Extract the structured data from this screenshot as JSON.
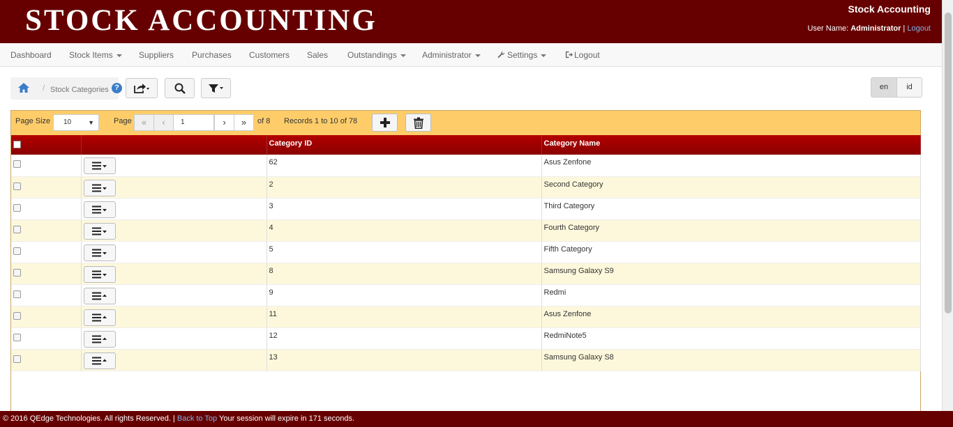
{
  "header": {
    "app_title": "STOCK ACCOUNTING",
    "brand_small": "Stock Accounting",
    "user_label": "User Name:",
    "user_name": "Administrator",
    "separator": "|",
    "logout_link": "Logout"
  },
  "nav": {
    "items": [
      {
        "label": "Dashboard",
        "icon": "",
        "dropdown": false
      },
      {
        "label": "Stock Items",
        "icon": "",
        "dropdown": true
      },
      {
        "label": "Suppliers",
        "icon": "",
        "dropdown": false
      },
      {
        "label": "Purchases",
        "icon": "",
        "dropdown": false
      },
      {
        "label": "Customers",
        "icon": "",
        "dropdown": false
      },
      {
        "label": "Sales",
        "icon": "",
        "dropdown": false
      },
      {
        "label": "Outstandings",
        "icon": "",
        "dropdown": true
      },
      {
        "label": "Administrator",
        "icon": "",
        "dropdown": true
      },
      {
        "label": "Settings",
        "icon": "wrench-icon",
        "dropdown": true
      },
      {
        "label": "Logout",
        "icon": "sign-out-icon",
        "dropdown": false
      }
    ]
  },
  "breadcrumb": {
    "home_icon": "home-icon",
    "separator": "/",
    "current": "Stock Categories",
    "help_icon": "question-circle-icon",
    "help_glyph": "?"
  },
  "toolbar": {
    "export_icon": "share-icon",
    "search_icon": "search-icon",
    "filter_icon": "filter-icon"
  },
  "language": {
    "options": [
      "en",
      "id"
    ],
    "active": "en"
  },
  "pager": {
    "page_size_label": "Page Size",
    "page_size_value": "10",
    "page_label": "Page",
    "first_glyph": "«",
    "prev_glyph": "‹",
    "current_page": "1",
    "next_glyph": "›",
    "last_glyph": "»",
    "of_pages": "of 8",
    "records_text": "Records 1 to 10 of 78",
    "add_icon": "plus-icon",
    "delete_icon": "trash-icon"
  },
  "grid": {
    "columns": [
      "",
      "",
      "Category ID",
      "Category Name"
    ],
    "rows": [
      {
        "id": "62",
        "name": "Asus Zenfone",
        "menu_caret": "down"
      },
      {
        "id": "2",
        "name": "Second Category",
        "menu_caret": "down"
      },
      {
        "id": "3",
        "name": "Third Category",
        "menu_caret": "down"
      },
      {
        "id": "4",
        "name": "Fourth Category",
        "menu_caret": "down"
      },
      {
        "id": "5",
        "name": "Fifth Category",
        "menu_caret": "down"
      },
      {
        "id": "8",
        "name": "Samsung Galaxy S9",
        "menu_caret": "down"
      },
      {
        "id": "9",
        "name": "Redmi",
        "menu_caret": "up"
      },
      {
        "id": "11",
        "name": "Asus Zenfone",
        "menu_caret": "up"
      },
      {
        "id": "12",
        "name": "RedmiNote5",
        "menu_caret": "up"
      },
      {
        "id": "13",
        "name": "Samsung Galaxy S8",
        "menu_caret": "up"
      }
    ]
  },
  "footer": {
    "copyright": "© 2016 QEdge Technologies. All rights Reserved. |",
    "back_to_top": "Back to Top",
    "session_text": "Your session will expire in 171 seconds."
  },
  "colors": {
    "header_bg": "#660000",
    "pager_bg": "#fecd6a",
    "grid_header": "#a00000",
    "row_alt": "#fdf8dc",
    "link": "#7fb3e6"
  }
}
